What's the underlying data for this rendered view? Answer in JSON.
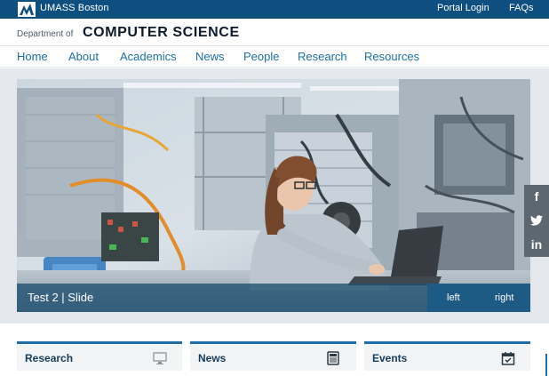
{
  "topbar": {
    "university": "UMASS Boston",
    "links": {
      "portal": "Portal Login",
      "faqs": "FAQs"
    }
  },
  "department": {
    "prefix": "Department of",
    "name": "COMPUTER SCIENCE"
  },
  "nav": {
    "items": [
      "Home",
      "About",
      "Academics",
      "News",
      "People",
      "Research",
      "Resources"
    ]
  },
  "hero": {
    "caption": "Test 2 | Slide",
    "controls": {
      "left": "left",
      "right": "right"
    }
  },
  "social": {
    "facebook": "f",
    "twitter": "t",
    "linkedin": "in"
  },
  "cards": [
    {
      "title": "Research",
      "icon": "computer-icon"
    },
    {
      "title": "News",
      "icon": "newspaper-icon"
    },
    {
      "title": "Events",
      "icon": "calendar-check-icon"
    }
  ],
  "colors": {
    "brand_blue": "#0f4f7f",
    "link_blue": "#1f6fa6",
    "caption_overlay": "#1e4e70"
  }
}
